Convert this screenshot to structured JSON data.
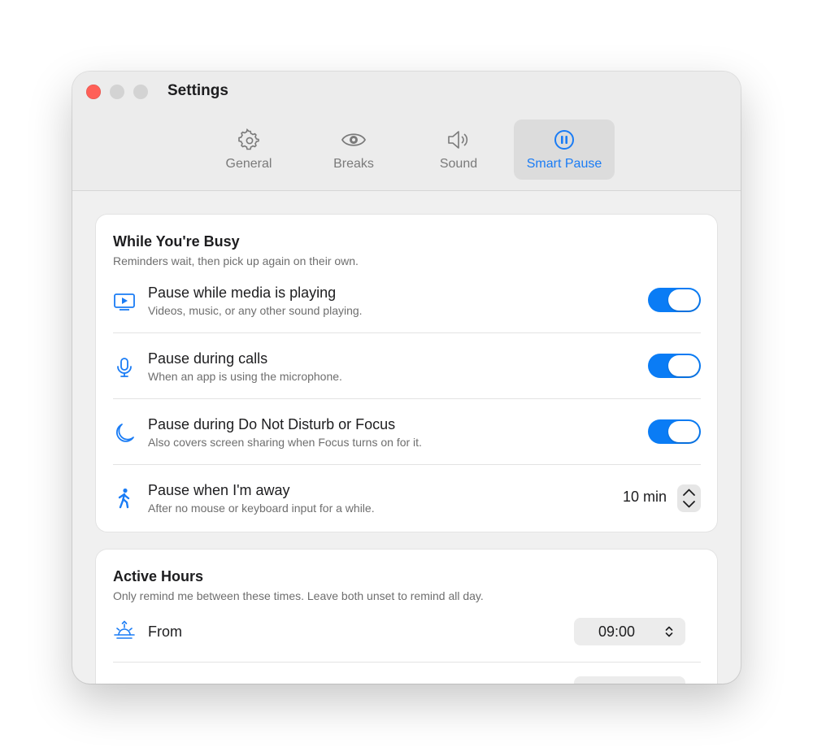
{
  "window": {
    "title": "Settings"
  },
  "toolbar": {
    "tabs": [
      {
        "label": "General",
        "icon": "gear-icon",
        "active": false
      },
      {
        "label": "Breaks",
        "icon": "eye-icon",
        "active": false
      },
      {
        "label": "Sound",
        "icon": "speaker-icon",
        "active": false
      },
      {
        "label": "Smart Pause",
        "icon": "pause-circle-icon",
        "active": true
      }
    ]
  },
  "busy": {
    "title": "While You're Busy",
    "subtitle": "Reminders wait, then pick up again on their own.",
    "rows": [
      {
        "label": "Pause while media is playing",
        "desc": "Videos, music, or any other sound playing.",
        "icon": "media-play-icon",
        "on": true
      },
      {
        "label": "Pause during calls",
        "desc": "When an app is using the microphone.",
        "icon": "microphone-icon",
        "on": true
      },
      {
        "label": "Pause during Do Not Disturb or Focus",
        "desc": "Also covers screen sharing when Focus turns on for it.",
        "icon": "moon-icon",
        "on": true
      },
      {
        "label": "Pause when I'm away",
        "desc": "After no mouse or keyboard input for a while.",
        "icon": "walking-person-icon",
        "value": "10 min"
      }
    ]
  },
  "active_hours": {
    "title": "Active Hours",
    "subtitle": "Only remind me between these times. Leave both unset to remind all day.",
    "from_label": "From",
    "from_value": "09:00",
    "from_icon": "sunrise-icon"
  },
  "colors": {
    "accent": "#0a7cf5",
    "close": "#ff5f57"
  }
}
